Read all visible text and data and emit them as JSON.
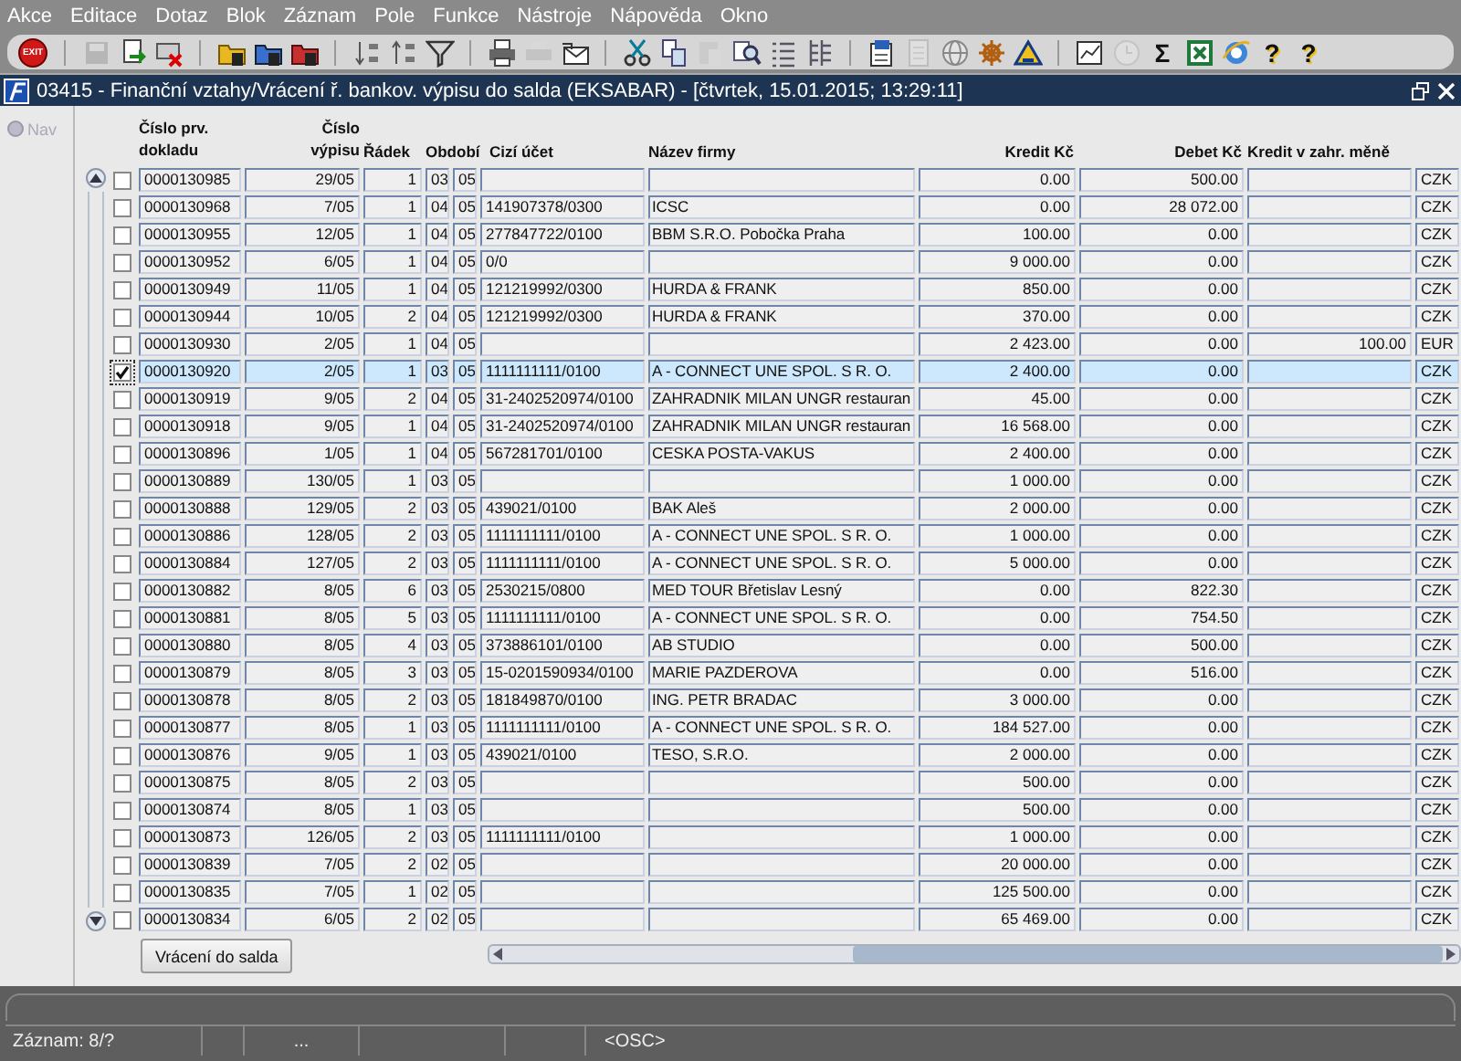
{
  "menu": [
    "Akce",
    "Editace",
    "Dotaz",
    "Blok",
    "Záznam",
    "Pole",
    "Funkce",
    "Nástroje",
    "Nápověda",
    "Okno"
  ],
  "toolbar": [
    {
      "kind": "exit",
      "label": "EXIT",
      "disabled": false
    },
    {
      "kind": "separator"
    },
    {
      "kind": "save",
      "disabled": true
    },
    {
      "kind": "commit",
      "disabled": false
    },
    {
      "kind": "remove",
      "disabled": false
    },
    {
      "kind": "separator"
    },
    {
      "kind": "query",
      "disabled": false
    },
    {
      "kind": "execute",
      "disabled": false
    },
    {
      "kind": "cancel",
      "disabled": false
    },
    {
      "kind": "separator"
    },
    {
      "kind": "sort-asc",
      "disabled": false
    },
    {
      "kind": "sort-desc",
      "disabled": false
    },
    {
      "kind": "filter",
      "disabled": false
    },
    {
      "kind": "separator"
    },
    {
      "kind": "print",
      "disabled": false
    },
    {
      "kind": "print-setup",
      "disabled": true
    },
    {
      "kind": "mail",
      "disabled": false
    },
    {
      "kind": "separator"
    },
    {
      "kind": "cut",
      "disabled": false
    },
    {
      "kind": "copy",
      "disabled": false
    },
    {
      "kind": "paste",
      "disabled": true
    },
    {
      "kind": "find",
      "disabled": false
    },
    {
      "kind": "list",
      "disabled": false
    },
    {
      "kind": "tree",
      "disabled": false
    },
    {
      "kind": "separator"
    },
    {
      "kind": "doc",
      "disabled": false
    },
    {
      "kind": "page",
      "disabled": true
    },
    {
      "kind": "globe",
      "disabled": false
    },
    {
      "kind": "gear",
      "disabled": false
    },
    {
      "kind": "triangle",
      "disabled": false
    },
    {
      "kind": "separator"
    },
    {
      "kind": "chart",
      "disabled": false
    },
    {
      "kind": "clock",
      "disabled": true
    },
    {
      "kind": "sum",
      "label": "Σ",
      "disabled": false
    },
    {
      "kind": "spreadsheet",
      "disabled": false
    },
    {
      "kind": "browser",
      "disabled": false
    },
    {
      "kind": "help",
      "label": "?",
      "disabled": false
    },
    {
      "kind": "help",
      "label": "?",
      "disabled": false
    }
  ],
  "window": {
    "title": "03415 - Finanční vztahy/Vrácení ř. bankov. výpisu do salda (EKSABAR) - [čtvrtek, 15.01.2015; 13:29:11]"
  },
  "nav": {
    "label": "Nav",
    "disabled": true
  },
  "table": {
    "columns": [
      "Číslo prv. dokladu",
      "Číslo výpisu",
      "Řádek",
      "Období",
      "Cizí účet",
      "Název firmy",
      "Kredit Kč",
      "Debet Kč",
      "Kredit v zahr. měně"
    ],
    "rows": [
      {
        "checked": false,
        "selected": false,
        "doc": "0000130985",
        "statement": "29/05",
        "line": "1",
        "month": "03",
        "year": "05",
        "credit": "0.00",
        "debit": "500.00",
        "currency": "CZK"
      },
      {
        "checked": false,
        "selected": false,
        "doc": "0000130968",
        "statement": "7/05",
        "line": "1",
        "month": "04",
        "year": "05",
        "account": "141907378/0300",
        "company": "ICSC",
        "credit": "0.00",
        "debit": "28 072.00",
        "currency": "CZK"
      },
      {
        "checked": false,
        "selected": false,
        "doc": "0000130955",
        "statement": "12/05",
        "line": "1",
        "month": "04",
        "year": "05",
        "account": "277847722/0100",
        "company": "BBM S.R.O. Pobočka Praha",
        "credit": "100.00",
        "debit": "0.00",
        "currency": "CZK"
      },
      {
        "checked": false,
        "selected": false,
        "doc": "0000130952",
        "statement": "6/05",
        "line": "1",
        "month": "04",
        "year": "05",
        "account": "0/0",
        "credit": "9 000.00",
        "debit": "0.00",
        "currency": "CZK"
      },
      {
        "checked": false,
        "selected": false,
        "doc": "0000130949",
        "statement": "11/05",
        "line": "1",
        "month": "04",
        "year": "05",
        "account": "121219992/0300",
        "company": "HURDA & FRANK",
        "credit": "850.00",
        "debit": "0.00",
        "currency": "CZK"
      },
      {
        "checked": false,
        "selected": false,
        "doc": "0000130944",
        "statement": "10/05",
        "line": "2",
        "month": "04",
        "year": "05",
        "account": "121219992/0300",
        "company": "HURDA & FRANK",
        "credit": "370.00",
        "debit": "0.00",
        "currency": "CZK"
      },
      {
        "checked": false,
        "selected": false,
        "doc": "0000130930",
        "statement": "2/05",
        "line": "1",
        "month": "04",
        "year": "05",
        "credit": "2 423.00",
        "debit": "0.00",
        "foreign": "100.00",
        "currency": "EUR"
      },
      {
        "checked": true,
        "selected": true,
        "doc": "0000130920",
        "statement": "2/05",
        "line": "1",
        "month": "03",
        "year": "05",
        "account": "1111111111/0100",
        "company": "A - CONNECT UNE SPOL. S R. O.",
        "credit": "2 400.00",
        "debit": "0.00",
        "currency": "CZK"
      },
      {
        "checked": false,
        "selected": false,
        "doc": "0000130919",
        "statement": "9/05",
        "line": "2",
        "month": "04",
        "year": "05",
        "account": "31-2402520974/0100",
        "company": "ZAHRADNIK MILAN UNGR restauran",
        "credit": "45.00",
        "debit": "0.00",
        "currency": "CZK"
      },
      {
        "checked": false,
        "selected": false,
        "doc": "0000130918",
        "statement": "9/05",
        "line": "1",
        "month": "04",
        "year": "05",
        "account": "31-2402520974/0100",
        "company": "ZAHRADNIK MILAN UNGR restauran",
        "credit": "16 568.00",
        "debit": "0.00",
        "currency": "CZK"
      },
      {
        "checked": false,
        "selected": false,
        "doc": "0000130896",
        "statement": "1/05",
        "line": "1",
        "month": "04",
        "year": "05",
        "account": "567281701/0100",
        "company": "CESKA POSTA-VAKUS",
        "credit": "2 400.00",
        "debit": "0.00",
        "currency": "CZK"
      },
      {
        "checked": false,
        "selected": false,
        "doc": "0000130889",
        "statement": "130/05",
        "line": "1",
        "month": "03",
        "year": "05",
        "credit": "1 000.00",
        "debit": "0.00",
        "currency": "CZK"
      },
      {
        "checked": false,
        "selected": false,
        "doc": "0000130888",
        "statement": "129/05",
        "line": "2",
        "month": "03",
        "year": "05",
        "account": "439021/0100",
        "company": "BAK Aleš",
        "credit": "2 000.00",
        "debit": "0.00",
        "currency": "CZK"
      },
      {
        "checked": false,
        "selected": false,
        "doc": "0000130886",
        "statement": "128/05",
        "line": "2",
        "month": "03",
        "year": "05",
        "account": "1111111111/0100",
        "company": "A - CONNECT UNE SPOL. S R. O.",
        "credit": "1 000.00",
        "debit": "0.00",
        "currency": "CZK"
      },
      {
        "checked": false,
        "selected": false,
        "doc": "0000130884",
        "statement": "127/05",
        "line": "2",
        "month": "03",
        "year": "05",
        "account": "1111111111/0100",
        "company": "A - CONNECT UNE SPOL. S R. O.",
        "credit": "5 000.00",
        "debit": "0.00",
        "currency": "CZK"
      },
      {
        "checked": false,
        "selected": false,
        "doc": "0000130882",
        "statement": "8/05",
        "line": "6",
        "month": "03",
        "year": "05",
        "account": "2530215/0800",
        "company": "MED TOUR Břetislav Lesný",
        "credit": "0.00",
        "debit": "822.30",
        "currency": "CZK"
      },
      {
        "checked": false,
        "selected": false,
        "doc": "0000130881",
        "statement": "8/05",
        "line": "5",
        "month": "03",
        "year": "05",
        "account": "1111111111/0100",
        "company": "A - CONNECT UNE SPOL. S R. O.",
        "credit": "0.00",
        "debit": "754.50",
        "currency": "CZK"
      },
      {
        "checked": false,
        "selected": false,
        "doc": "0000130880",
        "statement": "8/05",
        "line": "4",
        "month": "03",
        "year": "05",
        "account": "373886101/0100",
        "company": "AB STUDIO",
        "credit": "0.00",
        "debit": "500.00",
        "currency": "CZK"
      },
      {
        "checked": false,
        "selected": false,
        "doc": "0000130879",
        "statement": "8/05",
        "line": "3",
        "month": "03",
        "year": "05",
        "account": "15-0201590934/0100",
        "company": "MARIE PAZDEROVA",
        "credit": "0.00",
        "debit": "516.00",
        "currency": "CZK"
      },
      {
        "checked": false,
        "selected": false,
        "doc": "0000130878",
        "statement": "8/05",
        "line": "2",
        "month": "03",
        "year": "05",
        "account": "181849870/0100",
        "company": "ING. PETR BRADAC",
        "credit": "3 000.00",
        "debit": "0.00",
        "currency": "CZK"
      },
      {
        "checked": false,
        "selected": false,
        "doc": "0000130877",
        "statement": "8/05",
        "line": "1",
        "month": "03",
        "year": "05",
        "account": "1111111111/0100",
        "company": "A - CONNECT UNE SPOL. S R. O.",
        "credit": "184 527.00",
        "debit": "0.00",
        "currency": "CZK"
      },
      {
        "checked": false,
        "selected": false,
        "doc": "0000130876",
        "statement": "9/05",
        "line": "1",
        "month": "03",
        "year": "05",
        "account": "439021/0100",
        "company": "TESO, S.R.O.",
        "credit": "2 000.00",
        "debit": "0.00",
        "currency": "CZK"
      },
      {
        "checked": false,
        "selected": false,
        "doc": "0000130875",
        "statement": "8/05",
        "line": "2",
        "month": "03",
        "year": "05",
        "credit": "500.00",
        "debit": "0.00",
        "currency": "CZK"
      },
      {
        "checked": false,
        "selected": false,
        "doc": "0000130874",
        "statement": "8/05",
        "line": "1",
        "month": "03",
        "year": "05",
        "credit": "500.00",
        "debit": "0.00",
        "currency": "CZK"
      },
      {
        "checked": false,
        "selected": false,
        "doc": "0000130873",
        "statement": "126/05",
        "line": "2",
        "month": "03",
        "year": "05",
        "account": "1111111111/0100",
        "credit": "1 000.00",
        "debit": "0.00",
        "currency": "CZK"
      },
      {
        "checked": false,
        "selected": false,
        "doc": "0000130839",
        "statement": "7/05",
        "line": "2",
        "month": "02",
        "year": "05",
        "credit": "20 000.00",
        "debit": "0.00",
        "currency": "CZK"
      },
      {
        "checked": false,
        "selected": false,
        "doc": "0000130835",
        "statement": "7/05",
        "line": "1",
        "month": "02",
        "year": "05",
        "credit": "125 500.00",
        "debit": "0.00",
        "currency": "CZK"
      },
      {
        "checked": false,
        "selected": false,
        "doc": "0000130834",
        "statement": "6/05",
        "line": "2",
        "month": "02",
        "year": "05",
        "credit": "65 469.00",
        "debit": "0.00",
        "currency": "CZK"
      }
    ]
  },
  "action_button": "Vrácení do salda",
  "status_bar": {
    "record": "Záznam: 8/?",
    "info": "...",
    "mode": "<OSC>"
  }
}
